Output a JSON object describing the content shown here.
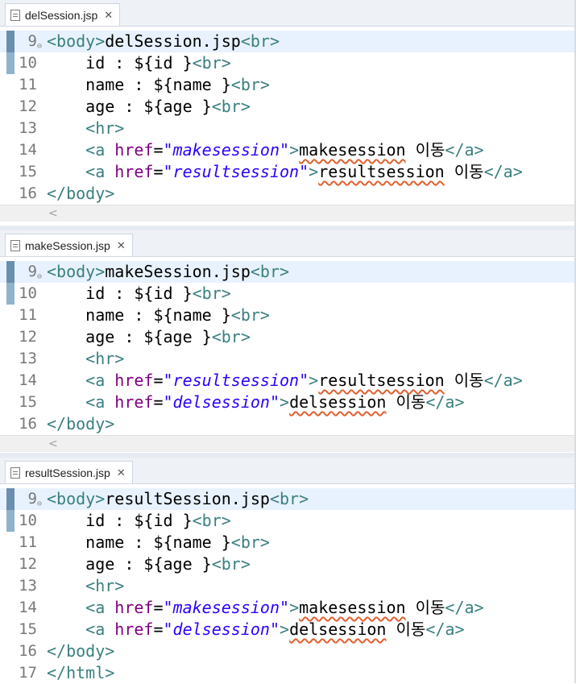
{
  "editors": [
    {
      "tab_title": "delSession.jsp",
      "lines": [
        {
          "num": "9",
          "fold": "⊖",
          "parts": [
            [
              "tag",
              "<body>"
            ],
            [
              "text",
              "delSession.jsp"
            ],
            [
              "tag",
              "<br>"
            ]
          ]
        },
        {
          "num": "10",
          "parts": [
            [
              "text",
              "    id : ${id }"
            ],
            [
              "tag",
              "<br>"
            ]
          ]
        },
        {
          "num": "11",
          "parts": [
            [
              "text",
              "    name : ${name }"
            ],
            [
              "tag",
              "<br>"
            ]
          ]
        },
        {
          "num": "12",
          "parts": [
            [
              "text",
              "    age : ${age }"
            ],
            [
              "tag",
              "<br>"
            ]
          ]
        },
        {
          "num": "13",
          "parts": [
            [
              "text",
              "    "
            ],
            [
              "tag",
              "<hr>"
            ]
          ]
        },
        {
          "num": "14",
          "parts": [
            [
              "text",
              "    "
            ],
            [
              "tag",
              "<a "
            ],
            [
              "attr",
              "href"
            ],
            [
              "text",
              "="
            ],
            [
              "str",
              "\"makesession\""
            ],
            [
              "tag",
              ">"
            ],
            [
              "sq",
              "makesession"
            ],
            [
              "text",
              " 이동"
            ],
            [
              "tag",
              "</a>"
            ]
          ]
        },
        {
          "num": "15",
          "parts": [
            [
              "text",
              "    "
            ],
            [
              "tag",
              "<a "
            ],
            [
              "attr",
              "href"
            ],
            [
              "text",
              "="
            ],
            [
              "str",
              "\"resultsession\""
            ],
            [
              "tag",
              ">"
            ],
            [
              "sq",
              "resultsession"
            ],
            [
              "text",
              " 이동"
            ],
            [
              "tag",
              "</a>"
            ]
          ]
        },
        {
          "num": "16",
          "parts": [
            [
              "tag",
              "</body>"
            ]
          ]
        }
      ]
    },
    {
      "tab_title": "makeSession.jsp",
      "lines": [
        {
          "num": "9",
          "fold": "⊖",
          "parts": [
            [
              "tag",
              "<body>"
            ],
            [
              "text",
              "makeSession.jsp"
            ],
            [
              "tag",
              "<br>"
            ]
          ]
        },
        {
          "num": "10",
          "parts": [
            [
              "text",
              "    id : ${id }"
            ],
            [
              "tag",
              "<br>"
            ]
          ]
        },
        {
          "num": "11",
          "parts": [
            [
              "text",
              "    name : ${name }"
            ],
            [
              "tag",
              "<br>"
            ]
          ]
        },
        {
          "num": "12",
          "parts": [
            [
              "text",
              "    age : ${age }"
            ],
            [
              "tag",
              "<br>"
            ]
          ]
        },
        {
          "num": "13",
          "parts": [
            [
              "text",
              "    "
            ],
            [
              "tag",
              "<hr>"
            ]
          ]
        },
        {
          "num": "14",
          "parts": [
            [
              "text",
              "    "
            ],
            [
              "tag",
              "<a "
            ],
            [
              "attr",
              "href"
            ],
            [
              "text",
              "="
            ],
            [
              "str",
              "\"resultsession\""
            ],
            [
              "tag",
              ">"
            ],
            [
              "sq",
              "resultsession"
            ],
            [
              "text",
              " 이동"
            ],
            [
              "tag",
              "</a>"
            ]
          ]
        },
        {
          "num": "15",
          "parts": [
            [
              "text",
              "    "
            ],
            [
              "tag",
              "<a "
            ],
            [
              "attr",
              "href"
            ],
            [
              "text",
              "="
            ],
            [
              "str",
              "\"delsession\""
            ],
            [
              "tag",
              ">"
            ],
            [
              "sq",
              "delsession"
            ],
            [
              "text",
              " 이동"
            ],
            [
              "tag",
              "</a>"
            ]
          ]
        },
        {
          "num": "16",
          "parts": [
            [
              "tag",
              "</body>"
            ]
          ]
        }
      ]
    },
    {
      "tab_title": "resultSession.jsp",
      "lines": [
        {
          "num": "9",
          "fold": "⊖",
          "parts": [
            [
              "tag",
              "<body>"
            ],
            [
              "text",
              "resultSession.jsp"
            ],
            [
              "tag",
              "<br>"
            ]
          ]
        },
        {
          "num": "10",
          "parts": [
            [
              "text",
              "    id : ${id }"
            ],
            [
              "tag",
              "<br>"
            ]
          ]
        },
        {
          "num": "11",
          "parts": [
            [
              "text",
              "    name : ${name }"
            ],
            [
              "tag",
              "<br>"
            ]
          ]
        },
        {
          "num": "12",
          "parts": [
            [
              "text",
              "    age : ${age }"
            ],
            [
              "tag",
              "<br>"
            ]
          ]
        },
        {
          "num": "13",
          "parts": [
            [
              "text",
              "    "
            ],
            [
              "tag",
              "<hr>"
            ]
          ]
        },
        {
          "num": "14",
          "parts": [
            [
              "text",
              "    "
            ],
            [
              "tag",
              "<a "
            ],
            [
              "attr",
              "href"
            ],
            [
              "text",
              "="
            ],
            [
              "str",
              "\"makesession\""
            ],
            [
              "tag",
              ">"
            ],
            [
              "sq",
              "makesession"
            ],
            [
              "text",
              " 이동"
            ],
            [
              "tag",
              "</a>"
            ]
          ]
        },
        {
          "num": "15",
          "parts": [
            [
              "text",
              "    "
            ],
            [
              "tag",
              "<a "
            ],
            [
              "attr",
              "href"
            ],
            [
              "text",
              "="
            ],
            [
              "str",
              "\"delsession\""
            ],
            [
              "tag",
              ">"
            ],
            [
              "sq",
              "delsession"
            ],
            [
              "text",
              " 이동"
            ],
            [
              "tag",
              "</a>"
            ]
          ]
        },
        {
          "num": "16",
          "parts": [
            [
              "tag",
              "</body>"
            ]
          ]
        },
        {
          "num": "17",
          "parts": [
            [
              "tag",
              "</html>"
            ]
          ]
        }
      ]
    }
  ],
  "close_glyph": "✕",
  "scroll_left_glyph": "<"
}
